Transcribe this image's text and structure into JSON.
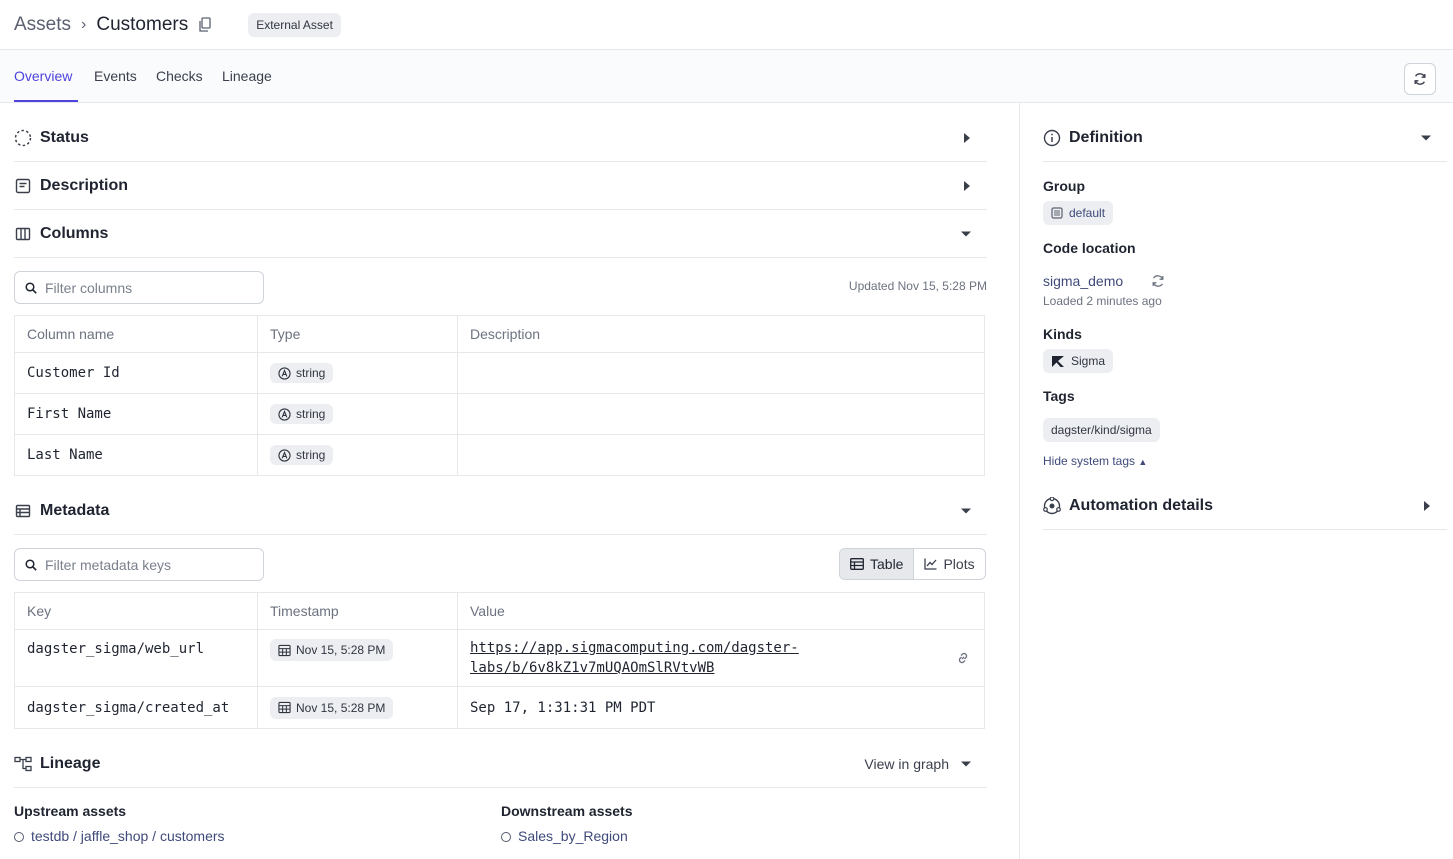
{
  "breadcrumb": {
    "root": "Assets",
    "current": "Customers",
    "badge": "External Asset"
  },
  "tabs": [
    {
      "label": "Overview",
      "active": true
    },
    {
      "label": "Events"
    },
    {
      "label": "Checks"
    },
    {
      "label": "Lineage"
    }
  ],
  "sections": {
    "status": "Status",
    "description": "Description",
    "columns": "Columns",
    "metadata": "Metadata",
    "lineage": "Lineage"
  },
  "columns": {
    "filter_placeholder": "Filter columns",
    "updated": "Updated Nov 15, 5:28 PM",
    "headers": [
      "Column name",
      "Type",
      "Description"
    ],
    "rows": [
      {
        "name": "Customer Id",
        "type": "string",
        "description": ""
      },
      {
        "name": "First Name",
        "type": "string",
        "description": ""
      },
      {
        "name": "Last Name",
        "type": "string",
        "description": ""
      }
    ]
  },
  "metadata": {
    "filter_placeholder": "Filter metadata keys",
    "view_table": "Table",
    "view_plots": "Plots",
    "headers": [
      "Key",
      "Timestamp",
      "Value"
    ],
    "rows": [
      {
        "key": "dagster_sigma/web_url",
        "timestamp": "Nov 15, 5:28 PM",
        "value_line1": "https://app.sigmacomputing.com/dagster-",
        "value_line2": "labs/b/6v8kZ1v7mUQAOmSlRVtvWB"
      },
      {
        "key": "dagster_sigma/created_at",
        "timestamp": "Nov 15, 5:28 PM",
        "value": "Sep 17, 1:31:31 PM PDT"
      }
    ]
  },
  "lineage": {
    "view_in_graph": "View in graph",
    "upstream_label": "Upstream assets",
    "upstream": "testdb / jaffle_shop / customers",
    "downstream_label": "Downstream assets",
    "downstream": "Sales_by_Region"
  },
  "definition": {
    "title": "Definition",
    "group_label": "Group",
    "group": "default",
    "code_location_label": "Code location",
    "code_location": "sigma_demo",
    "loaded": "Loaded 2 minutes ago",
    "kinds_label": "Kinds",
    "kind": "Sigma",
    "tags_label": "Tags",
    "tag": "dagster/kind/sigma",
    "hide_system_tags": "Hide system tags"
  },
  "automation": {
    "title": "Automation details"
  },
  "colors": {
    "accent": "#4f43dd",
    "border": "#e6e8ec",
    "chip": "#eceef1"
  }
}
